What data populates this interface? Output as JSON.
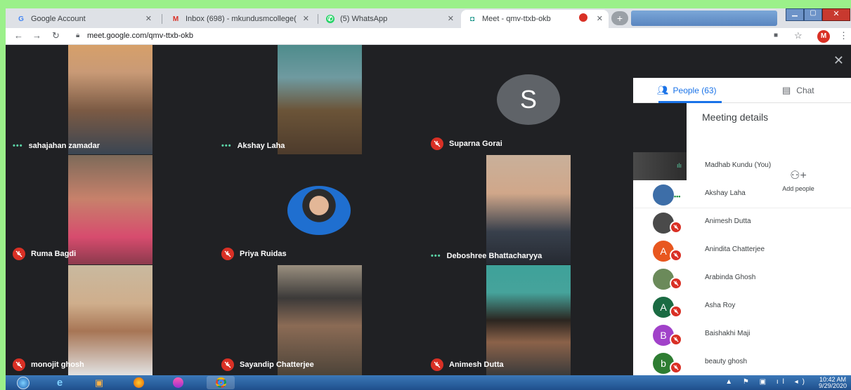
{
  "browser": {
    "tabs": [
      {
        "title": "Google Account",
        "icon": "google-icon"
      },
      {
        "title": "Inbox (698) - mkundusmcollege(",
        "icon": "gmail-icon"
      },
      {
        "title": "(5) WhatsApp",
        "icon": "whatsapp-icon"
      },
      {
        "title": "Meet - qmv-ttxb-okb",
        "icon": "meet-icon"
      }
    ],
    "url": "meet.google.com/qmv-ttxb-okb",
    "profile_initial": "M"
  },
  "tiles": [
    {
      "name": "sahajahan zamadar",
      "status": "speaking",
      "color": "#8a6a4a"
    },
    {
      "name": "Akshay Laha",
      "status": "speaking",
      "color": "#5a6b4a"
    },
    {
      "name": "Suparna Gorai",
      "status": "muted",
      "avatar_letter": "S",
      "color": "#5f6368"
    },
    {
      "name": "Ruma Bagdi",
      "status": "muted",
      "color": "#b07a7a"
    },
    {
      "name": "Priya Ruidas",
      "status": "muted",
      "color": "#2d63b3"
    },
    {
      "name": "Deboshree Bhattacharyya",
      "status": "speaking",
      "color": "#a89580"
    },
    {
      "name": "monojit ghosh",
      "status": "muted",
      "color": "#a19582"
    },
    {
      "name": "Sayandip Chatterjee",
      "status": "muted",
      "color": "#5b5247"
    },
    {
      "name": "Animesh Dutta",
      "status": "muted",
      "color": "#4a8a84"
    }
  ],
  "panel": {
    "people_tab": "People (63)",
    "chat_tab": "Chat",
    "meeting_details": "Meeting details",
    "add_people": "Add people",
    "participants": [
      {
        "name": "Madhab Kundu (You)",
        "avatar": "video",
        "color": "#333"
      },
      {
        "name": "Akshay Laha",
        "avatar": "photo",
        "color": "#3d6ea8"
      },
      {
        "name": "Animesh Dutta",
        "avatar": "photo",
        "color": "#4a4a4a"
      },
      {
        "name": "Anindita Chatterjee",
        "avatar": "A",
        "color": "#e8571f"
      },
      {
        "name": "Arabinda Ghosh",
        "avatar": "photo",
        "color": "#6b8a5a"
      },
      {
        "name": "Asha Roy",
        "avatar": "A",
        "color": "#1b6b43"
      },
      {
        "name": "Baishakhi Maji",
        "avatar": "B",
        "color": "#a142c9"
      },
      {
        "name": "beauty ghosh",
        "avatar": "b",
        "color": "#2e7d32"
      }
    ]
  },
  "taskbar": {
    "time": "10:42 AM",
    "date": "9/29/2020"
  }
}
